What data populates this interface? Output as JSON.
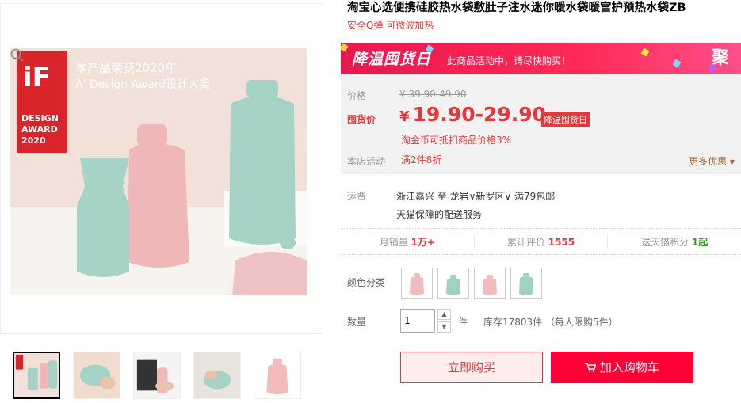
{
  "product": {
    "title": "淘宝心选便携硅胶热水袋敷肚子注水迷你暖水袋暖宫护预热水袋ZB",
    "subtitle": "安全Q弹 可微波加热"
  },
  "main_image": {
    "award_logo": "iF",
    "award_text1": "DESIGN",
    "award_text2": "AWARD",
    "award_year": "2020",
    "headline1": "本产品荣获2020年",
    "headline2": "A' Design Award设计大奖"
  },
  "promo": {
    "logo": "降温囤货日",
    "text": "此商品活动中，请尽快购买！",
    "badge": "聚"
  },
  "price": {
    "orig_label": "价格",
    "orig_value": "¥ 39.90-49.90",
    "now_label": "囤货价",
    "currency": "¥",
    "now_value": "19.90-29.90",
    "tag": "降温囤货日",
    "coin_note": "淘金币可抵扣商品价格3%",
    "store_label": "本店活动",
    "store_value": "满2件8折",
    "more": "更多优惠"
  },
  "shipping": {
    "label": "运费",
    "route": "浙江嘉兴 至 龙岩∨新罗区∨ 满79包邮",
    "note": "天猫保障的配送服务"
  },
  "stats": {
    "monthly_label": "月销量",
    "monthly_value": "1万+",
    "reviews_label": "累计评价",
    "reviews_value": "1555",
    "points_label": "送天猫积分",
    "points_value": "1起"
  },
  "options": {
    "color_label": "颜色分类",
    "qty_label": "数量",
    "qty_value": "1",
    "qty_unit": "件",
    "stock": "库存17803件 （每人限购5件）"
  },
  "actions": {
    "buy_now": "立即购买",
    "add_cart": "加入购物车"
  },
  "colors": {
    "mint": "#9fd1c4",
    "pink": "#f2bcbc",
    "accent": "#e4393c",
    "cart": "#ff0036"
  }
}
